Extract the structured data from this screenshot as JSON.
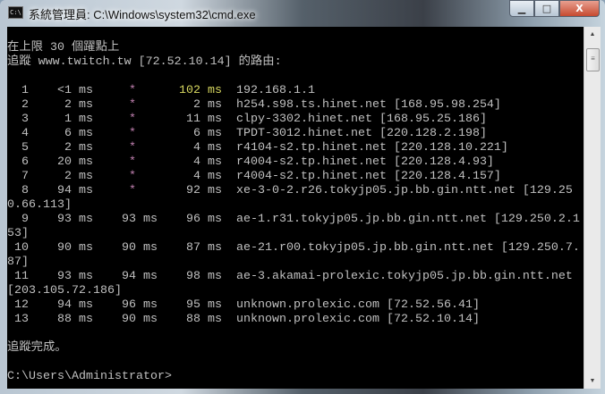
{
  "window": {
    "title": "系統管理員: C:\\Windows\\system32\\cmd.exe",
    "icon": "C:\\",
    "minimize": "▁",
    "maximize": "□",
    "close": "X"
  },
  "console": {
    "header_lines": [
      "",
      "在上限 30 個躍點上",
      "追蹤 www.twitch.tw [72.52.10.14] 的路由:",
      ""
    ],
    "hops": [
      {
        "hop": "1",
        "t1": "<1 ms",
        "t2": "*",
        "t3": "102 ms",
        "host": "192.168.1.1"
      },
      {
        "hop": "2",
        "t1": "2 ms",
        "t2": "*",
        "t3": "2 ms",
        "host": "h254.s98.ts.hinet.net [168.95.98.254]"
      },
      {
        "hop": "3",
        "t1": "1 ms",
        "t2": "*",
        "t3": "11 ms",
        "host": "clpy-3302.hinet.net [168.95.25.186]"
      },
      {
        "hop": "4",
        "t1": "6 ms",
        "t2": "*",
        "t3": "6 ms",
        "host": "TPDT-3012.hinet.net [220.128.2.198]"
      },
      {
        "hop": "5",
        "t1": "2 ms",
        "t2": "*",
        "t3": "4 ms",
        "host": "r4104-s2.tp.hinet.net [220.128.10.221]"
      },
      {
        "hop": "6",
        "t1": "20 ms",
        "t2": "*",
        "t3": "4 ms",
        "host": "r4004-s2.tp.hinet.net [220.128.4.93]"
      },
      {
        "hop": "7",
        "t1": "2 ms",
        "t2": "*",
        "t3": "4 ms",
        "host": "r4004-s2.tp.hinet.net [220.128.4.157]"
      },
      {
        "hop": "8",
        "t1": "94 ms",
        "t2": "*",
        "t3": "92 ms",
        "host": "xe-3-0-2.r26.tokyjp05.jp.bb.gin.ntt.net [129.250.66.113]"
      },
      {
        "hop": "9",
        "t1": "93 ms",
        "t2": "93 ms",
        "t3": "96 ms",
        "host": "ae-1.r31.tokyjp05.jp.bb.gin.ntt.net [129.250.2.153]"
      },
      {
        "hop": "10",
        "t1": "90 ms",
        "t2": "90 ms",
        "t3": "87 ms",
        "host": "ae-21.r00.tokyjp05.jp.bb.gin.ntt.net [129.250.7.87]"
      },
      {
        "hop": "11",
        "t1": "93 ms",
        "t2": "94 ms",
        "t3": "98 ms",
        "host": "ae-3.akamai-prolexic.tokyjp05.jp.bb.gin.ntt.net [203.105.72.186]"
      },
      {
        "hop": "12",
        "t1": "94 ms",
        "t2": "96 ms",
        "t3": "95 ms",
        "host": "unknown.prolexic.com [72.52.56.41]"
      },
      {
        "hop": "13",
        "t1": "88 ms",
        "t2": "90 ms",
        "t3": "88 ms",
        "host": "unknown.prolexic.com [72.52.10.14]"
      }
    ],
    "footer_lines": [
      "",
      "追蹤完成。",
      ""
    ],
    "prompt": "C:\\Users\\Administrator>"
  },
  "colors": {
    "background": "#000000",
    "text": "#c0c0c0",
    "timeout_star": "#c080b0",
    "highlight": "#d8d860"
  },
  "scrollbar": {
    "up": "▲",
    "down": "▼",
    "thumb": "≡"
  }
}
